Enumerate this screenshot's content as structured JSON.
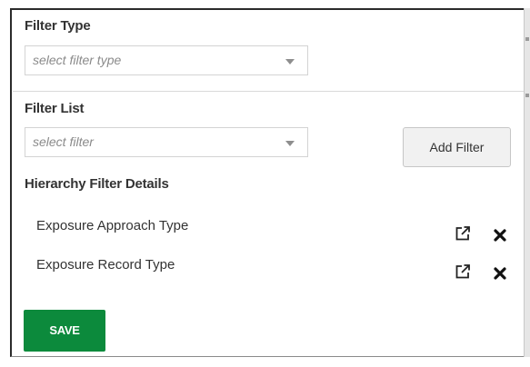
{
  "filter_type": {
    "label": "Filter Type",
    "placeholder": "select filter type"
  },
  "filter_list": {
    "label": "Filter List",
    "placeholder": "select filter",
    "add_button_label": "Add Filter"
  },
  "hierarchy": {
    "heading": "Hierarchy Filter Details",
    "items": [
      {
        "label": "Exposure Approach Type",
        "actions": [
          "external-link-icon",
          "close-icon"
        ]
      },
      {
        "label": "Exposure Record Type",
        "actions": [
          "external-link-icon",
          "close-icon"
        ]
      }
    ]
  },
  "save_label": "SAVE",
  "colors": {
    "save_button": "#0c8a3c",
    "text": "#333333",
    "placeholder": "#8a8a8a"
  }
}
